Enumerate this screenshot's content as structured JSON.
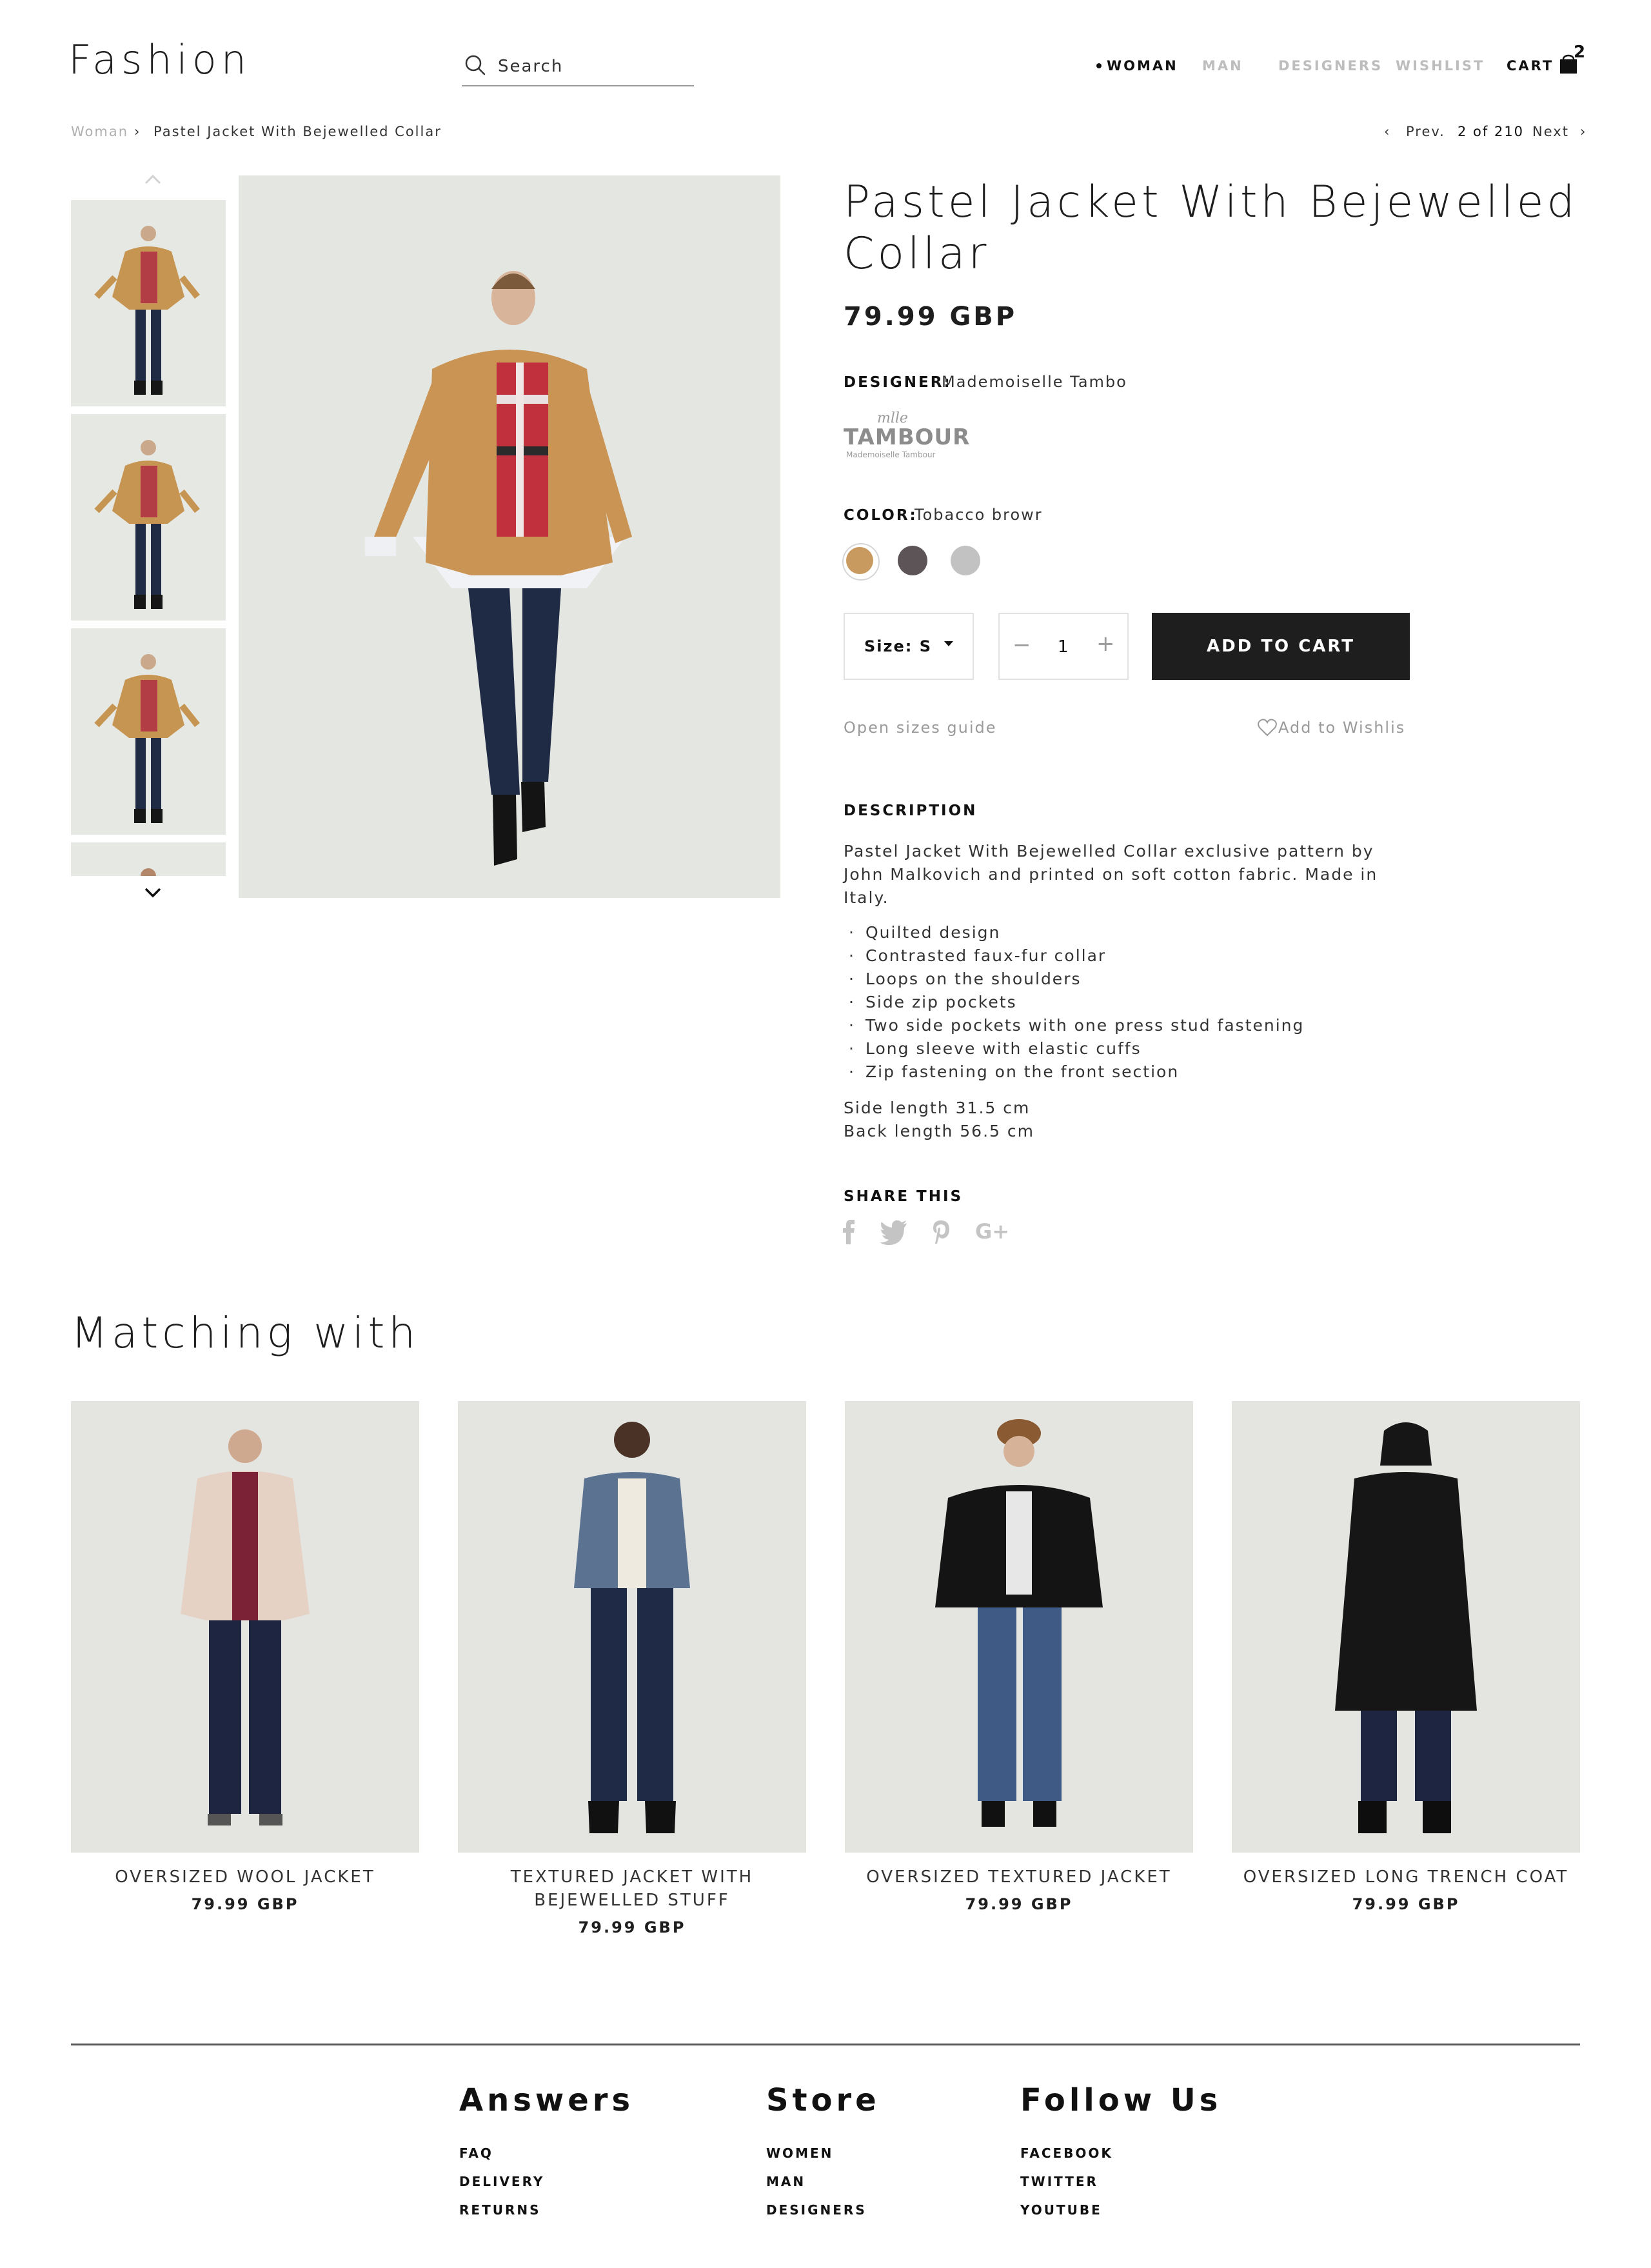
{
  "header": {
    "logo": "Fashion",
    "search_placeholder": "Search",
    "nav": [
      "WOMAN",
      "MAN",
      "DESIGNERS",
      "WISHLIST"
    ],
    "cart_label": "CART",
    "cart_count": "2"
  },
  "breadcrumb": {
    "parent": "Woman",
    "current": "Pastel Jacket With Bejewelled Collar",
    "prev": "Prev.",
    "position": "2 of 210",
    "next": "Next"
  },
  "product": {
    "title": "Pastel Jacket With Bejewelled Collar",
    "price": "79.99 GBP",
    "designer_label": "DESIGNER:",
    "designer": "Mademoiselle Tambo",
    "brand_logo_small": "mlle",
    "brand_logo_main": "TAMBOUR",
    "brand_logo_sub": "Mademoiselle Tambour",
    "color_label": "COLOR:",
    "color": "Tobacco browr",
    "swatches": [
      "#c99a5f",
      "#5c5456",
      "#c2c2c2"
    ],
    "size_label": "Size: S",
    "quantity": "1",
    "add_to_cart": "ADD TO CART",
    "sizes_guide": "Open sizes guide",
    "wishlist": "Add to Wishlis",
    "description_label": "DESCRIPTION",
    "description": "Pastel Jacket With Bejewelled Collar exclusive pattern by John Malkovich and printed on soft cotton fabric. Made in Italy.",
    "features": [
      "Quilted design",
      "Contrasted faux-fur collar",
      "Loops on the shoulders",
      "Side zip pockets",
      "Two side pockets with one press stud fastening",
      "Long sleeve with elastic cuffs",
      "Zip fastening on the front section"
    ],
    "side_length": "Side length 31.5 cm",
    "back_length": "Back length 56.5 cm",
    "share_label": "SHARE THIS",
    "share_icons": [
      "facebook-icon",
      "twitter-icon",
      "pinterest-icon",
      "google-plus-icon"
    ]
  },
  "matching": {
    "title": "Matching with",
    "items": [
      {
        "name": "OVERSIZED WOOL JACKET",
        "price": "79.99 GBP"
      },
      {
        "name": "TEXTURED JACKET WITH BEJEWELLED STUFF",
        "price": "79.99 GBP"
      },
      {
        "name": "OVERSIZED TEXTURED JACKET",
        "price": "79.99 GBP"
      },
      {
        "name": "OVERSIZED LONG TRENCH COAT",
        "price": "79.99 GBP"
      }
    ]
  },
  "footer": {
    "columns": [
      {
        "title": "Answers",
        "links": [
          "FAQ",
          "DELIVERY",
          "RETURNS"
        ]
      },
      {
        "title": "Store",
        "links": [
          "WOMEN",
          "MAN",
          "DESIGNERS"
        ]
      },
      {
        "title": "Follow Us",
        "links": [
          "FACEBOOK",
          "TWITTER",
          "YOUTUBE"
        ]
      }
    ]
  },
  "colors": {
    "accent_dark": "#1e1e1e",
    "muted": "#9a9a9a",
    "photo_bg": "#e4e6e2"
  }
}
